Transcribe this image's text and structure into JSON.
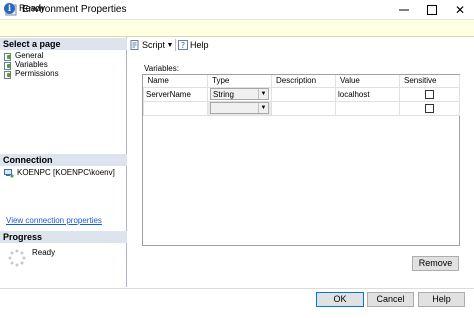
{
  "window": {
    "title": "Environment Properties",
    "close_glyph": "✕"
  },
  "status": {
    "text": "Ready"
  },
  "left_pane": {
    "select_page_header": "Select a page",
    "pages": [
      {
        "label": "General"
      },
      {
        "label": "Variables"
      },
      {
        "label": "Permissions"
      }
    ],
    "connection_header": "Connection",
    "connection_text": "KOENPC [KOENPC\\koenv]",
    "view_connection_link": "View connection properties",
    "progress_header": "Progress",
    "progress_text": "Ready"
  },
  "toolbar": {
    "script_label": "Script",
    "help_label": "Help"
  },
  "variables": {
    "label": "Variables:",
    "columns": [
      "Name",
      "Type",
      "Description",
      "Value",
      "Sensitive"
    ],
    "rows": [
      {
        "name": "ServerName",
        "type": "String",
        "description": "",
        "value": "localhost",
        "sensitive": false
      },
      {
        "name": "",
        "type": "",
        "description": "",
        "value": "",
        "sensitive": false
      }
    ]
  },
  "buttons": {
    "remove": "Remove",
    "ok": "OK",
    "cancel": "Cancel",
    "help": "Help"
  },
  "colors": {
    "accent": "#0078d7",
    "link": "#1a5bd6",
    "status_bg": "#ffffe1",
    "section_header_bg": "#dde4ee"
  }
}
